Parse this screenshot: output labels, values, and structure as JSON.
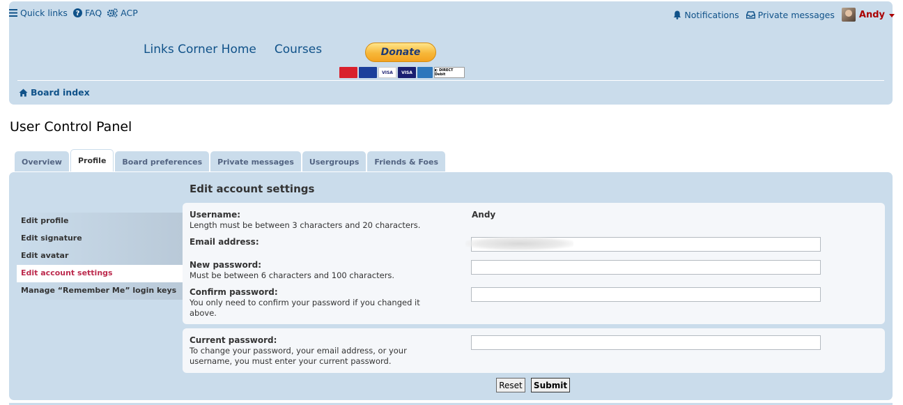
{
  "nav": {
    "quick_links": "Quick links",
    "faq": "FAQ",
    "acp": "ACP",
    "notifications": "Notifications",
    "private_messages": "Private messages",
    "username": "Andy"
  },
  "site": {
    "links_corner_home": "Links Corner Home",
    "courses": "Courses",
    "donate": "Donate",
    "payment_cards": [
      "Mastercard",
      "Maestro",
      "VISA",
      "VISA",
      "AMEX",
      "Direct Debit"
    ]
  },
  "breadcrumb": {
    "board_index": "Board index"
  },
  "page_title": "User Control Panel",
  "tabs": [
    {
      "label": "Overview",
      "active": false
    },
    {
      "label": "Profile",
      "active": true
    },
    {
      "label": "Board preferences",
      "active": false
    },
    {
      "label": "Private messages",
      "active": false
    },
    {
      "label": "Usergroups",
      "active": false
    },
    {
      "label": "Friends & Foes",
      "active": false
    }
  ],
  "menu": [
    {
      "label": "Edit profile",
      "active": false
    },
    {
      "label": "Edit signature",
      "active": false
    },
    {
      "label": "Edit avatar",
      "active": false
    },
    {
      "label": "Edit account settings",
      "active": true
    },
    {
      "label": "Manage “Remember Me” login keys",
      "active": false
    }
  ],
  "form": {
    "title": "Edit account settings",
    "username_label": "Username:",
    "username_explain": "Length must be between 3 characters and 20 characters.",
    "username_value": "Andy",
    "email_label": "Email address:",
    "new_password_label": "New password:",
    "new_password_explain": "Must be between 6 characters and 100 characters.",
    "confirm_password_label": "Confirm password:",
    "confirm_password_explain": "You only need to confirm your password if you changed it above.",
    "current_password_label": "Current password:",
    "current_password_explain": "To change your password, your email address, or your username, you must enter your current password.",
    "reset": "Reset",
    "submit": "Submit"
  },
  "colors": {
    "header_bg": "#cadceb",
    "link": "#105289",
    "username": "#aa0000",
    "active_menu": "#bc2a4d"
  }
}
